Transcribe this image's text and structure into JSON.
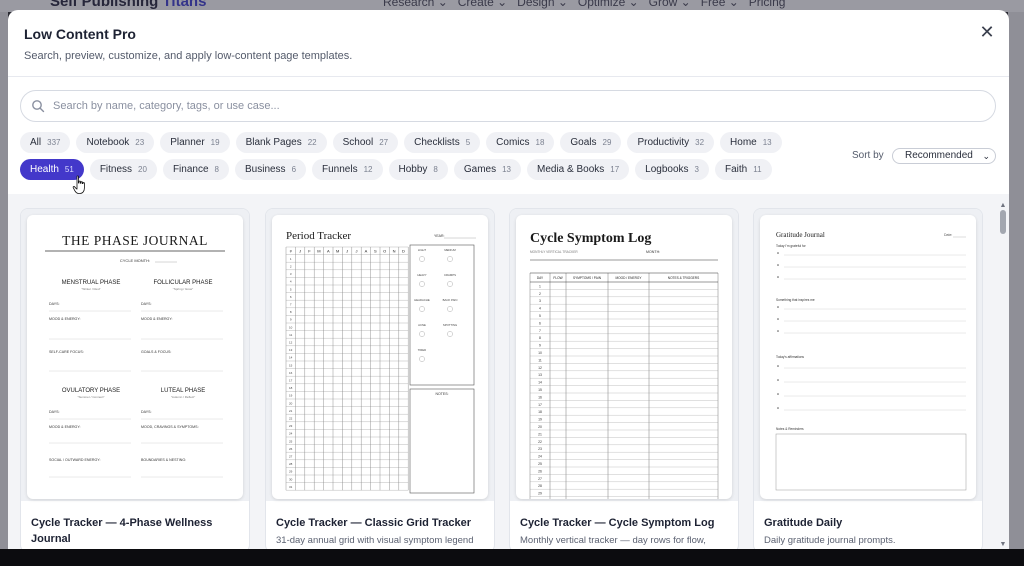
{
  "background": {
    "brand": "Self Publishing",
    "brand_accent": "Titans",
    "menu": [
      "Research ⌄",
      "Create ⌄",
      "Design ⌄",
      "Optimize ⌄",
      "Grow ⌄",
      "Free ⌄",
      "Pricing"
    ]
  },
  "modal": {
    "title": "Low Content Pro",
    "subtitle": "Search, preview, customize, and apply low-content page templates.",
    "close_icon": "close-icon"
  },
  "search": {
    "placeholder": "Search by name, category, tags, or use case..."
  },
  "filters": {
    "row1": [
      {
        "label": "All",
        "count": "337"
      },
      {
        "label": "Notebook",
        "count": "23"
      },
      {
        "label": "Planner",
        "count": "19"
      },
      {
        "label": "Blank Pages",
        "count": "22"
      },
      {
        "label": "School",
        "count": "27"
      },
      {
        "label": "Checklists",
        "count": "5"
      },
      {
        "label": "Comics",
        "count": "18"
      },
      {
        "label": "Goals",
        "count": "29"
      },
      {
        "label": "Productivity",
        "count": "32"
      },
      {
        "label": "Home",
        "count": "13"
      }
    ],
    "row2": [
      {
        "label": "Health",
        "count": "51",
        "active": true
      },
      {
        "label": "Fitness",
        "count": "20"
      },
      {
        "label": "Finance",
        "count": "8"
      },
      {
        "label": "Business",
        "count": "6"
      },
      {
        "label": "Funnels",
        "count": "12"
      },
      {
        "label": "Hobby",
        "count": "8"
      },
      {
        "label": "Games",
        "count": "13"
      },
      {
        "label": "Media & Books",
        "count": "17"
      },
      {
        "label": "Logbooks",
        "count": "3"
      },
      {
        "label": "Faith",
        "count": "11"
      }
    ],
    "active_color": "#4338ca"
  },
  "sort": {
    "label": "Sort by",
    "value": "Recommended"
  },
  "cards": [
    {
      "title": "Cycle Tracker — 4-Phase Wellness Journal",
      "desc": "",
      "preview": {
        "heading": "THE PHASE JOURNAL",
        "sub": "CYCLE MONTH:",
        "phases": [
          "MENSTRUAL PHASE",
          "FOLLICULAR PHASE",
          "OVULATORY PHASE",
          "LUTEAL PHASE"
        ],
        "phase_notes": [
          "\"Winter / Rest\"",
          "\"Spring / Grow\"",
          "\"Summer / Connect\"",
          "\"Autumn / Reflect\""
        ],
        "fields": [
          "DAYS:",
          "MOOD & ENERGY:",
          "SELF-CARE FOCUS:",
          "GOALS & FOCUS:",
          "MOOD, CRAVINGS & SYMPTOMS:",
          "SOCIAL / OUTWARD ENERGY:",
          "BOUNDARIES & NESTING:"
        ]
      }
    },
    {
      "title": "Cycle Tracker — Classic Grid Tracker",
      "desc": "31-day annual grid with visual symptom legend",
      "preview": {
        "heading": "Period Tracker",
        "year": "YEAR:",
        "months": [
          "J",
          "F",
          "M",
          "A",
          "M",
          "J",
          "J",
          "A",
          "S",
          "O",
          "N",
          "D"
        ],
        "legend": [
          "LIGHT",
          "MEDIUM",
          "HEAVY",
          "CRAMPS",
          "HEADACHE",
          "BACK PAIN",
          "ACNE",
          "SPOTTING",
          "TIRED"
        ],
        "notes": "NOTES:"
      }
    },
    {
      "title": "Cycle Tracker — Cycle Symptom Log",
      "desc": "Monthly vertical tracker — day rows for flow,",
      "preview": {
        "heading": "Cycle Symptom Log",
        "sub": "MONTHLY VERTICAL TRACKER",
        "month": "MONTH:",
        "columns": [
          "DAY",
          "FLOW",
          "SYMPTOMS / PAIN",
          "MOOD / ENERGY",
          "NOTES & TRIGGERS"
        ]
      }
    },
    {
      "title": "Gratitude Daily",
      "desc": "Daily gratitude journal prompts.",
      "preview": {
        "heading": "Gratitude Journal",
        "date": "Date:",
        "prompts": [
          "Today I'm grateful for",
          "Something that inspires me",
          "Today's affirmations",
          "Notes & Reminders"
        ]
      }
    }
  ]
}
